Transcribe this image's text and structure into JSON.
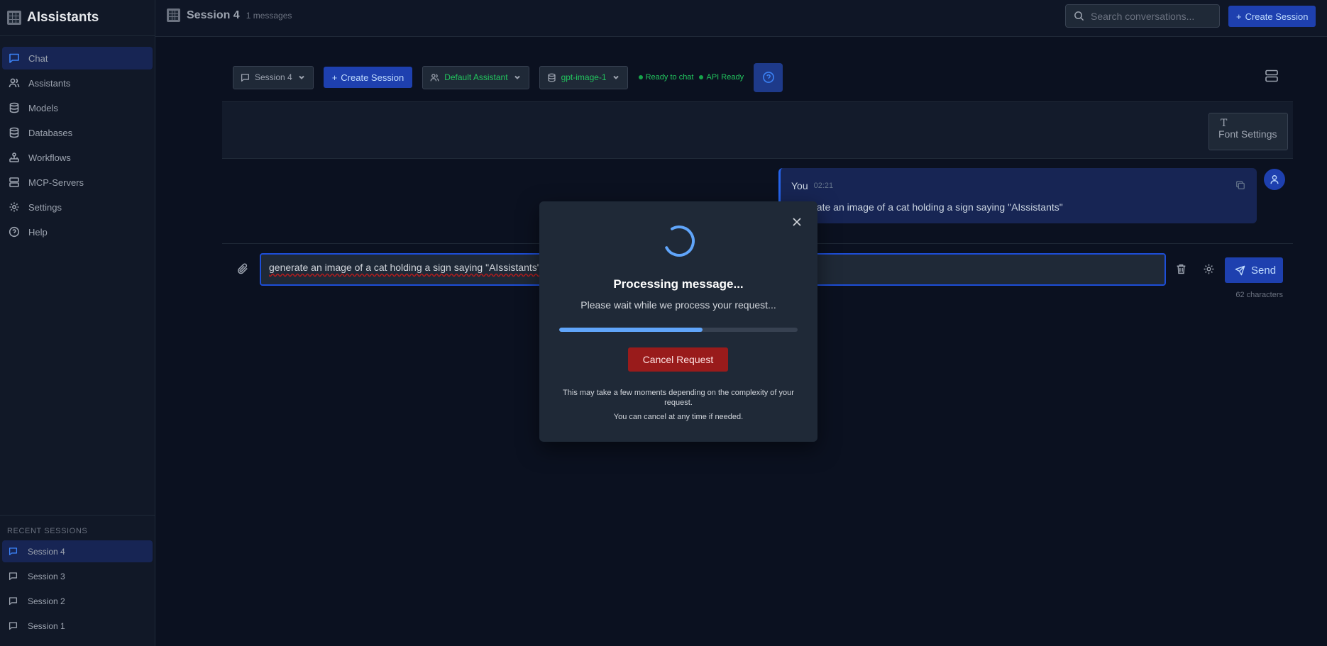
{
  "app": {
    "name": "AIssistants"
  },
  "sidebar": {
    "items": [
      {
        "label": "Chat",
        "icon": "chat-icon",
        "active": true
      },
      {
        "label": "Assistants",
        "icon": "users-icon"
      },
      {
        "label": "Models",
        "icon": "database-icon"
      },
      {
        "label": "Databases",
        "icon": "database-icon"
      },
      {
        "label": "Workflows",
        "icon": "workflow-icon"
      },
      {
        "label": "MCP-Servers",
        "icon": "server-icon"
      },
      {
        "label": "Settings",
        "icon": "gear-icon"
      },
      {
        "label": "Help",
        "icon": "help-circle-icon"
      }
    ],
    "recent_title": "RECENT SESSIONS",
    "recent": [
      {
        "label": "Session 4",
        "active": true
      },
      {
        "label": "Session 3"
      },
      {
        "label": "Session 2"
      },
      {
        "label": "Session 1"
      }
    ]
  },
  "header": {
    "session_title": "Session 4",
    "message_count": "1 messages",
    "search_placeholder": "Search conversations...",
    "create_label": "Create Session"
  },
  "toolbar": {
    "session_select": "Session 4",
    "create_label": "Create Session",
    "assistant_select": "Default Assistant",
    "model_select": "gpt-image-1",
    "status_chat": "Ready to chat",
    "status_api": "API Ready"
  },
  "font_settings": {
    "label": "Font Settings"
  },
  "messages": [
    {
      "author": "You",
      "time": "02:21",
      "text": "generate an image of a cat holding a sign saying \"AIssistants\""
    }
  ],
  "composer": {
    "value": "generate an image of a cat holding a sign saying \"AIssistants\"",
    "send_label": "Send",
    "char_count": "62 characters"
  },
  "modal": {
    "title": "Processing message...",
    "subtitle": "Please wait while we process your request...",
    "progress": 0.6,
    "cancel_label": "Cancel Request",
    "note": "This may take a few moments depending on the complexity of your request.",
    "note2": "You can cancel at any time if needed."
  },
  "colors": {
    "accent": "#1e40af",
    "status_green": "#22c55e",
    "danger": "#991b1b",
    "progress": "#60a5fa"
  }
}
